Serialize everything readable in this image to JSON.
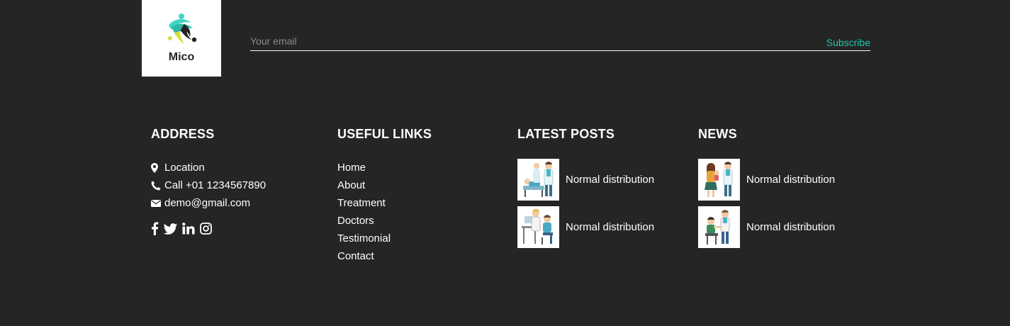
{
  "brand": {
    "name": "Mico",
    "colors": {
      "accent": "#1fc6a8",
      "background": "#252525",
      "logo_teal": "#3fd6c3",
      "logo_yellow": "#d8df3a",
      "logo_dark": "#222222"
    }
  },
  "newsletter": {
    "placeholder": "Your email",
    "value": "",
    "button_label": "Subscribe"
  },
  "address": {
    "heading": "ADDRESS",
    "items": [
      {
        "icon": "map-marker-icon",
        "text": "Location"
      },
      {
        "icon": "phone-icon",
        "text": "Call +01 1234567890"
      },
      {
        "icon": "envelope-icon",
        "text": "demo@gmail.com"
      }
    ],
    "social": [
      "facebook-icon",
      "twitter-icon",
      "linkedin-icon",
      "instagram-icon"
    ]
  },
  "useful_links": {
    "heading": "USEFUL LINKS",
    "items": [
      "Home",
      "About",
      "Treatment",
      "Doctors",
      "Testimonial",
      "Contact"
    ]
  },
  "latest_posts": {
    "heading": "LATEST POSTS",
    "items": [
      {
        "title": "Normal distribution",
        "image": "doctor-patient-bed-illustration"
      },
      {
        "title": "Normal distribution",
        "image": "doctor-desk-consult-illustration"
      }
    ]
  },
  "news": {
    "heading": "NEWS",
    "items": [
      {
        "title": "Normal distribution",
        "image": "mother-child-doctor-illustration"
      },
      {
        "title": "Normal distribution",
        "image": "doctor-patient-checkup-illustration"
      }
    ]
  }
}
